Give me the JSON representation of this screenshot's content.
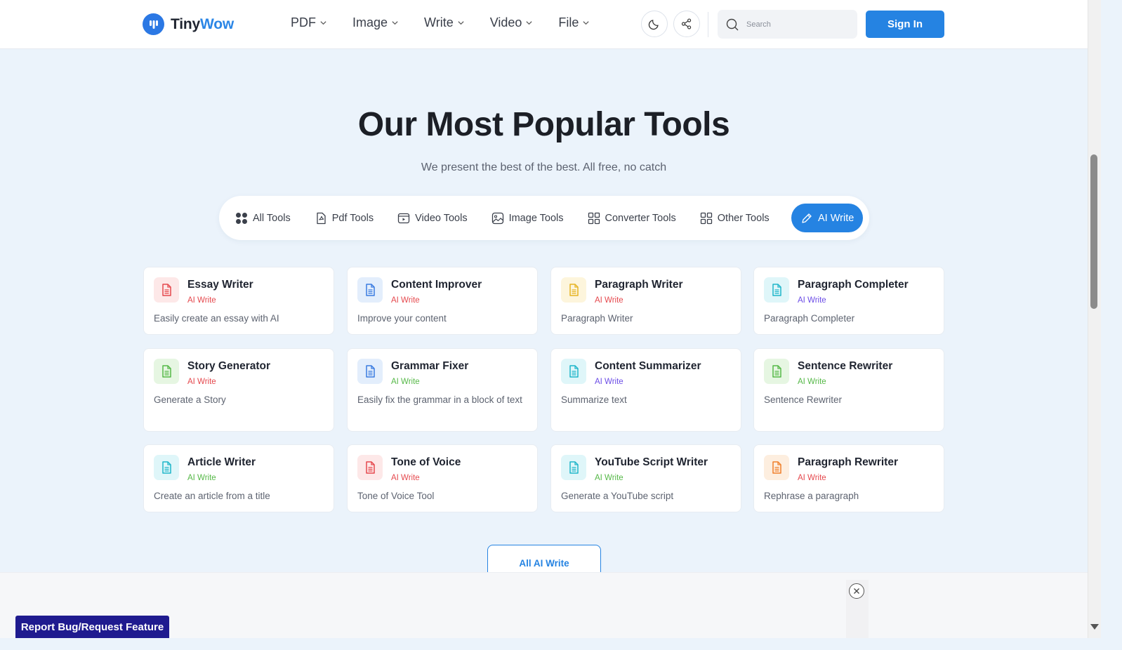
{
  "header": {
    "logo": {
      "part1": "Tiny",
      "part2": "Wow"
    },
    "nav": [
      {
        "label": "PDF"
      },
      {
        "label": "Image"
      },
      {
        "label": "Write"
      },
      {
        "label": "Video"
      },
      {
        "label": "File"
      }
    ],
    "search_placeholder": "Search",
    "signin_label": "Sign In"
  },
  "hero": {
    "title": "Our Most Popular Tools",
    "subtitle": "We present the best of the best. All free, no catch"
  },
  "tabs": [
    {
      "label": "All Tools",
      "icon": "grid-dots-icon"
    },
    {
      "label": "Pdf Tools",
      "icon": "pdf-file-icon"
    },
    {
      "label": "Video Tools",
      "icon": "video-icon"
    },
    {
      "label": "Image Tools",
      "icon": "image-icon"
    },
    {
      "label": "Converter Tools",
      "icon": "converter-grid-icon"
    },
    {
      "label": "Other Tools",
      "icon": "other-grid-icon"
    },
    {
      "label": "AI Write",
      "icon": "pencil-icon",
      "active": true
    }
  ],
  "cards": [
    {
      "title": "Essay Writer",
      "category": "AI Write",
      "desc": "Easily create an essay with AI",
      "color": "#e5484d",
      "bg": "#fde8e8",
      "cat_color": "#e5484d"
    },
    {
      "title": "Content Improver",
      "category": "AI Write",
      "desc": "Improve your content",
      "color": "#3a7be0",
      "bg": "#e3eefc",
      "cat_color": "#e5484d"
    },
    {
      "title": "Paragraph Writer",
      "category": "AI Write",
      "desc": "Paragraph Writer",
      "color": "#e6b422",
      "bg": "#fdf5dc",
      "cat_color": "#e5484d"
    },
    {
      "title": "Paragraph Completer",
      "category": "AI Write",
      "desc": "Paragraph Completer",
      "color": "#1fb5c9",
      "bg": "#dff6f9",
      "cat_color": "#6b4ce6"
    },
    {
      "title": "Story Generator",
      "category": "AI Write",
      "desc": "Generate a Story",
      "color": "#55b847",
      "bg": "#e6f6e2",
      "cat_color": "#e5484d"
    },
    {
      "title": "Grammar Fixer",
      "category": "AI Write",
      "desc": "Easily fix the grammar in a block of text",
      "color": "#3a7be0",
      "bg": "#e3eefc",
      "cat_color": "#55b847"
    },
    {
      "title": "Content Summarizer",
      "category": "AI Write",
      "desc": "Summarize text",
      "color": "#1fb5c9",
      "bg": "#dff6f9",
      "cat_color": "#6b4ce6"
    },
    {
      "title": "Sentence Rewriter",
      "category": "AI Write",
      "desc": "Sentence Rewriter",
      "color": "#55b847",
      "bg": "#e6f6e2",
      "cat_color": "#55b847"
    },
    {
      "title": "Article Writer",
      "category": "AI Write",
      "desc": "Create an article from a title",
      "color": "#1fb5c9",
      "bg": "#dff6f9",
      "cat_color": "#55b847"
    },
    {
      "title": "Tone of Voice",
      "category": "AI Write",
      "desc": "Tone of Voice Tool",
      "color": "#e5484d",
      "bg": "#fde8e8",
      "cat_color": "#e5484d"
    },
    {
      "title": "YouTube Script Writer",
      "category": "AI Write",
      "desc": "Generate a YouTube script",
      "color": "#1fb5c9",
      "bg": "#dff6f9",
      "cat_color": "#55b847"
    },
    {
      "title": "Paragraph Rewriter",
      "category": "AI Write",
      "desc": "Rephrase a paragraph",
      "color": "#f07f2a",
      "bg": "#fdeedf",
      "cat_color": "#e5484d"
    }
  ],
  "all_button_label": "All AI Write",
  "report_label": "Report Bug/Request Feature"
}
